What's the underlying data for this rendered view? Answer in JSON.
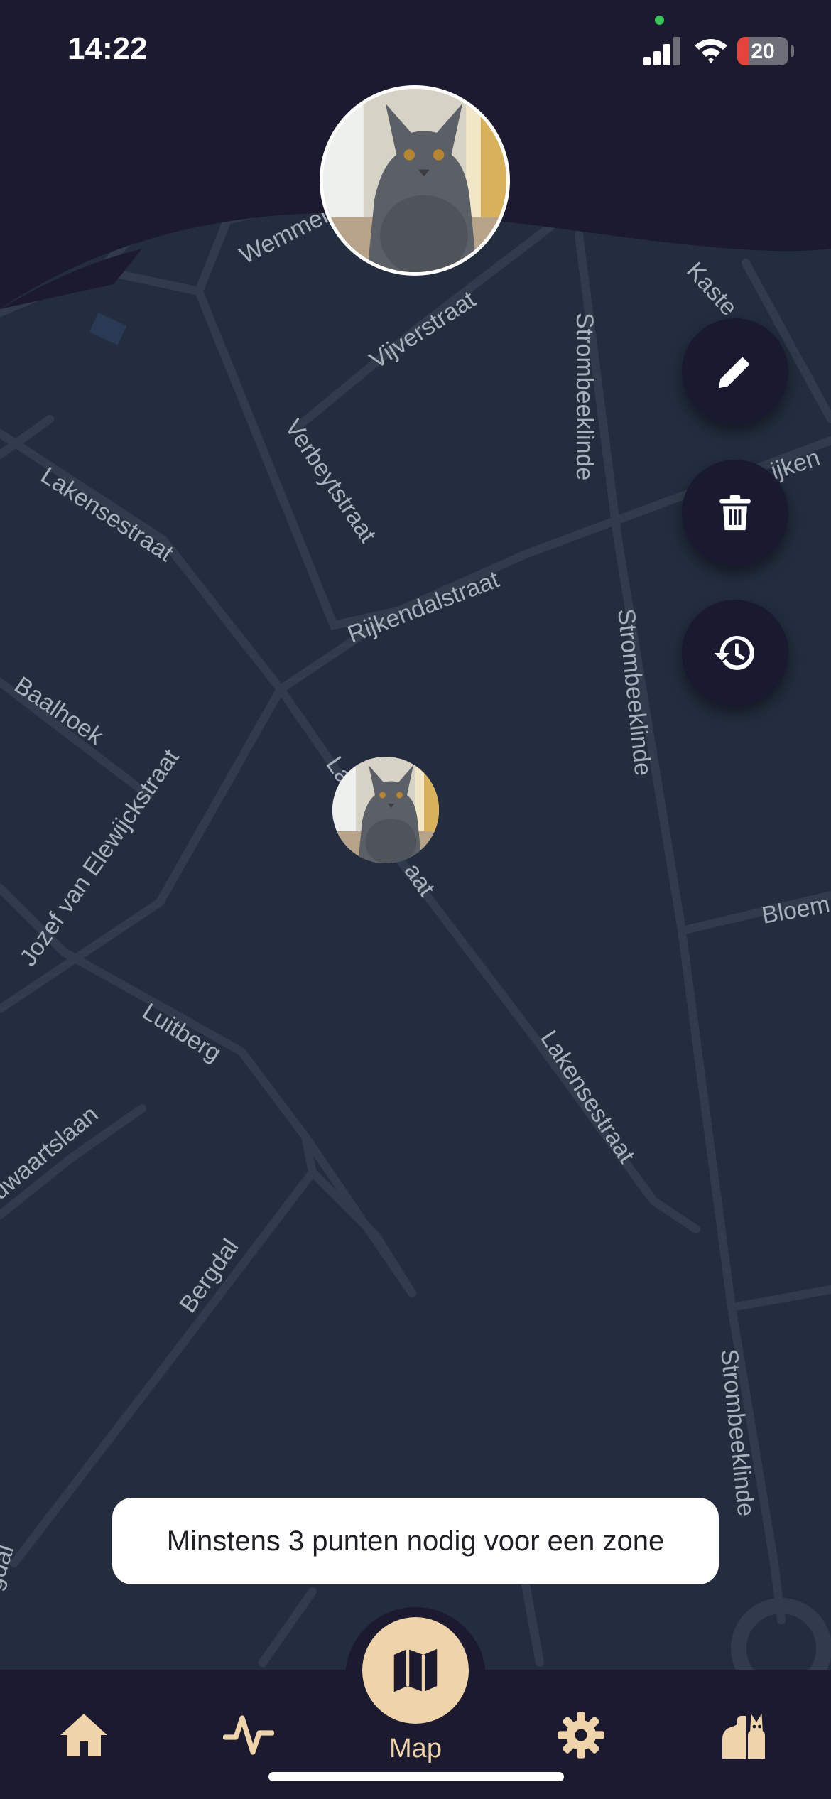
{
  "status_bar": {
    "time": "14:22",
    "battery": "20"
  },
  "map": {
    "streets": [
      "Wemmel",
      "Vijverstraat",
      "Strombeeklinde",
      "Kaste",
      "ijken",
      "Verbeytstraat",
      "Lakensestraat",
      "Rijkendalstraat",
      "Strombeeklinde",
      "Baalhoek",
      "Jozef van Elewijckstraat",
      "La",
      "aat",
      "Bloem",
      "Luitberg",
      "Lakensestraat",
      "uwaartslaan",
      "Bergdal",
      "Strombeeklinde",
      "gdal"
    ]
  },
  "pet": {
    "avatar_icon": "cat-photo"
  },
  "actions": {
    "edit_icon": "pencil-icon",
    "delete_icon": "trash-icon",
    "history_icon": "history-icon"
  },
  "toast": {
    "message": "Minstens 3 punten nodig voor een zone"
  },
  "nav": {
    "items": [
      {
        "icon": "home-icon"
      },
      {
        "icon": "activity-icon"
      },
      {
        "icon": "map-icon",
        "label": "Map"
      },
      {
        "icon": "gear-icon"
      },
      {
        "icon": "cat-icon"
      }
    ],
    "accent": "#efd3a9",
    "background": "#1b1a2f"
  }
}
